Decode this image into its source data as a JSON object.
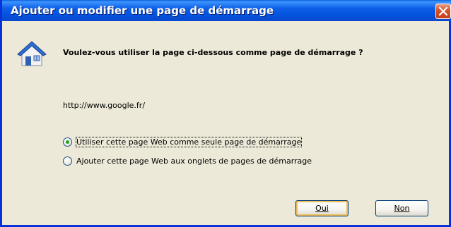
{
  "dialog": {
    "title": "Ajouter ou modifier une page de démarrage",
    "question": "Voulez-vous utiliser la page ci-dessous comme page de démarrage ?",
    "url": "http://www.google.fr/",
    "options": [
      {
        "label": "Utiliser cette page Web comme seule page de démarrage",
        "selected": true
      },
      {
        "label": "Ajouter cette page Web aux onglets de pages de démarrage",
        "selected": false
      }
    ],
    "buttons": {
      "yes_label": "Oui",
      "no_label": "Non"
    }
  },
  "icons": {
    "title_close": "close-icon",
    "main": "house-icon"
  },
  "colors": {
    "titlebar": "#0a5fd8",
    "dialog_background": "#ece9d8",
    "close_button": "#d7542f",
    "radio_selected": "#21a121"
  }
}
